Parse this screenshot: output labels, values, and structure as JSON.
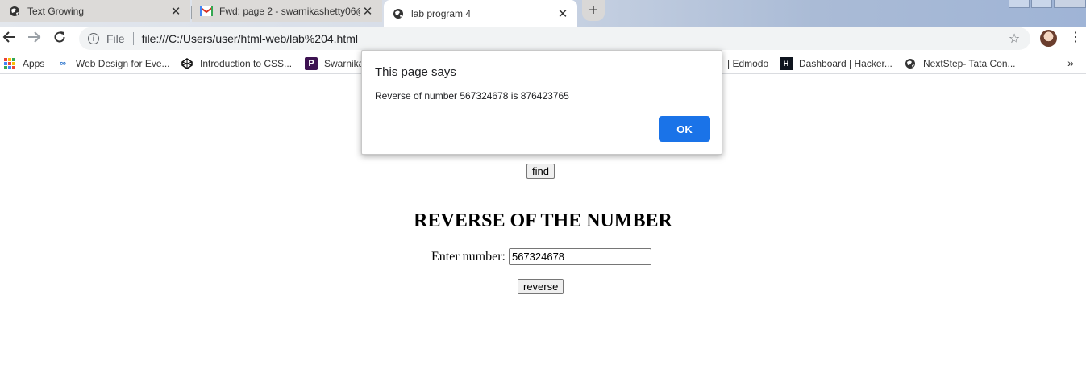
{
  "tabs": [
    {
      "title": "Text Growing",
      "icon": "globe-icon"
    },
    {
      "title": "Fwd: page 2 - swarnikashetty06@",
      "icon": "gmail-icon"
    },
    {
      "title": "lab program 4",
      "icon": "globe-icon"
    }
  ],
  "new_tab_label": "+",
  "toolbar": {
    "scheme": "File",
    "url": "file:///C:/Users/user/html-web/lab%204.html"
  },
  "bookmarks": [
    {
      "label": "Apps",
      "icon": "apps-grid-icon"
    },
    {
      "label": "Web Design for Eve...",
      "icon": "coursera-icon"
    },
    {
      "label": "Introduction to CSS...",
      "icon": "codepen-icon"
    },
    {
      "label": "Swarnika",
      "icon": "p-icon"
    },
    {
      "label": "| Edmodo",
      "icon": ""
    },
    {
      "label": "Dashboard | Hacker...",
      "icon": "hackerrank-icon"
    },
    {
      "label": "NextStep- Tata Con...",
      "icon": "globe-icon"
    }
  ],
  "bookmarks_more": "»",
  "page": {
    "find_button": "find",
    "heading": "REVERSE OF THE NUMBER",
    "input_label": "Enter number:",
    "input_value": "567324678",
    "reverse_button": "reverse"
  },
  "dialog": {
    "title": "This page says",
    "message": "Reverse of number 567324678 is 876423765",
    "ok_label": "OK"
  },
  "colors": {
    "accent": "#1a73e8",
    "tabstrip": "#dee1e6"
  }
}
